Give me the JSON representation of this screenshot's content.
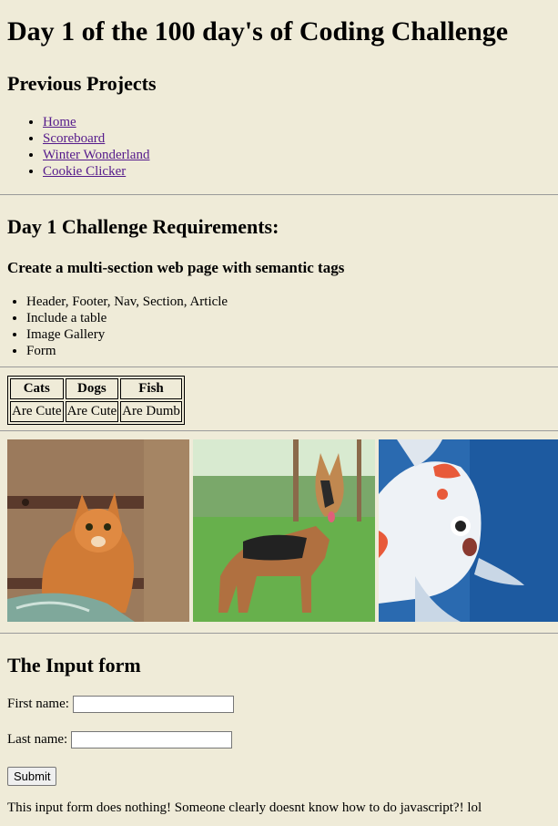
{
  "page": {
    "title": "Day 1 of the 100 day's of Coding Challenge",
    "previous_projects_heading": "Previous Projects",
    "nav": [
      {
        "label": "Home"
      },
      {
        "label": "Scoreboard"
      },
      {
        "label": "Winter Wonderland"
      },
      {
        "label": "Cookie Clicker"
      }
    ],
    "requirements_heading": "Day 1 Challenge Requirements:",
    "requirements_subheading": "Create a multi-section web page with semantic tags",
    "requirements": [
      "Header, Footer, Nav, Section, Article",
      "Include a table",
      "Image Gallery",
      "Form"
    ]
  },
  "table": {
    "headers": [
      "Cats",
      "Dogs",
      "Fish"
    ],
    "rows": [
      [
        "Are Cute",
        "Are Cute",
        "Are Dumb"
      ]
    ]
  },
  "gallery": {
    "images": [
      {
        "subject": "orange-tabby-cat"
      },
      {
        "subject": "german-shepherd-dog"
      },
      {
        "subject": "koi-fish"
      }
    ]
  },
  "form": {
    "heading": "The Input form",
    "first_name_label": "First name:",
    "first_name_value": "",
    "last_name_label": "Last name:",
    "last_name_value": "",
    "submit_label": "Submit",
    "note": "This input form does nothing! Someone clearly doesnt know how to do javascript?! lol"
  },
  "colors": {
    "background": "#efebd8",
    "link": "#551a8b"
  }
}
